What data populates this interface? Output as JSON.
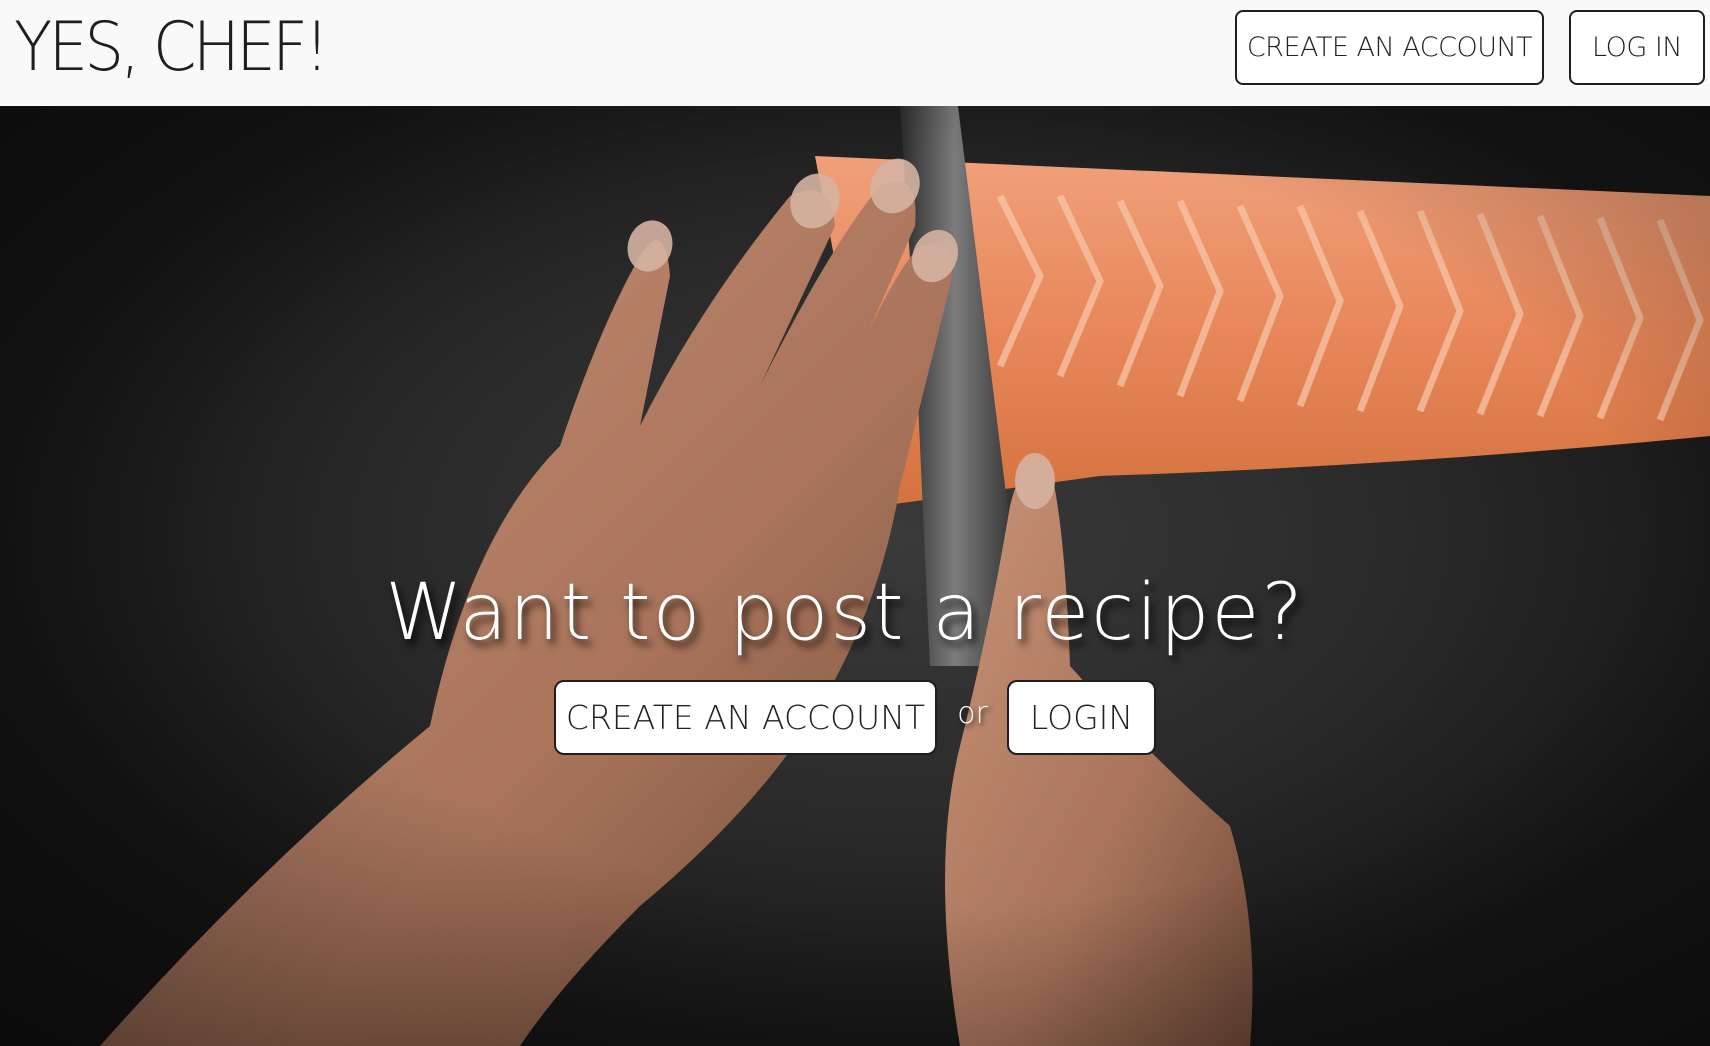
{
  "brand": {
    "title": "YES, CHEF!"
  },
  "nav": {
    "create_account_label": "CREATE AN ACCOUNT",
    "login_label": "LOG IN"
  },
  "hero": {
    "headline": "Want to post a recipe?",
    "create_account_label": "CREATE AN ACCOUNT",
    "separator": "or",
    "login_label": "LOGIN",
    "background_image": "hands slicing salmon fillet with knife on dark stone surface"
  },
  "colors": {
    "navbar_bg": "#f9f9f9",
    "text_dark": "#1e1e1e",
    "button_bg": "#ffffff",
    "hero_text": "#ffffff",
    "salmon": "#e8875a"
  }
}
